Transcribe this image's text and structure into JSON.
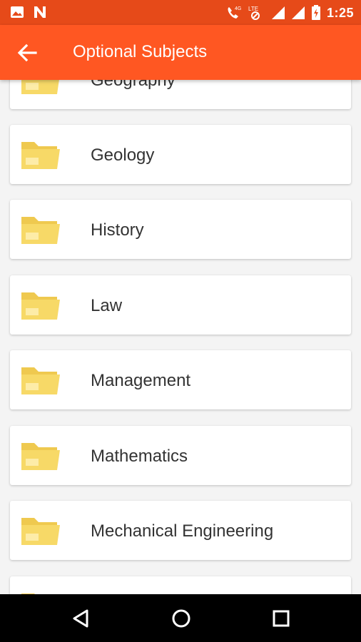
{
  "status_bar": {
    "time": "1:25",
    "network_label": "4G",
    "lte_label": "LTE",
    "icons": [
      "image-icon",
      "notification-n-icon",
      "call-volte-icon",
      "signal-icon",
      "signal-icon",
      "battery-icon"
    ]
  },
  "app_bar": {
    "title": "Optional Subjects",
    "back_icon": "arrow-back-icon"
  },
  "colors": {
    "status_bar": "#e64a19",
    "app_bar": "#ff5722",
    "folder": "#f7d967",
    "folder_back": "#efc94f"
  },
  "subjects": [
    "Geography",
    "Geology",
    "History",
    "Law",
    "Management",
    "Mathematics",
    "Mechanical Engineering"
  ],
  "nav_bar": {
    "icons": [
      "back-triangle-icon",
      "home-circle-icon",
      "recents-square-icon"
    ]
  }
}
